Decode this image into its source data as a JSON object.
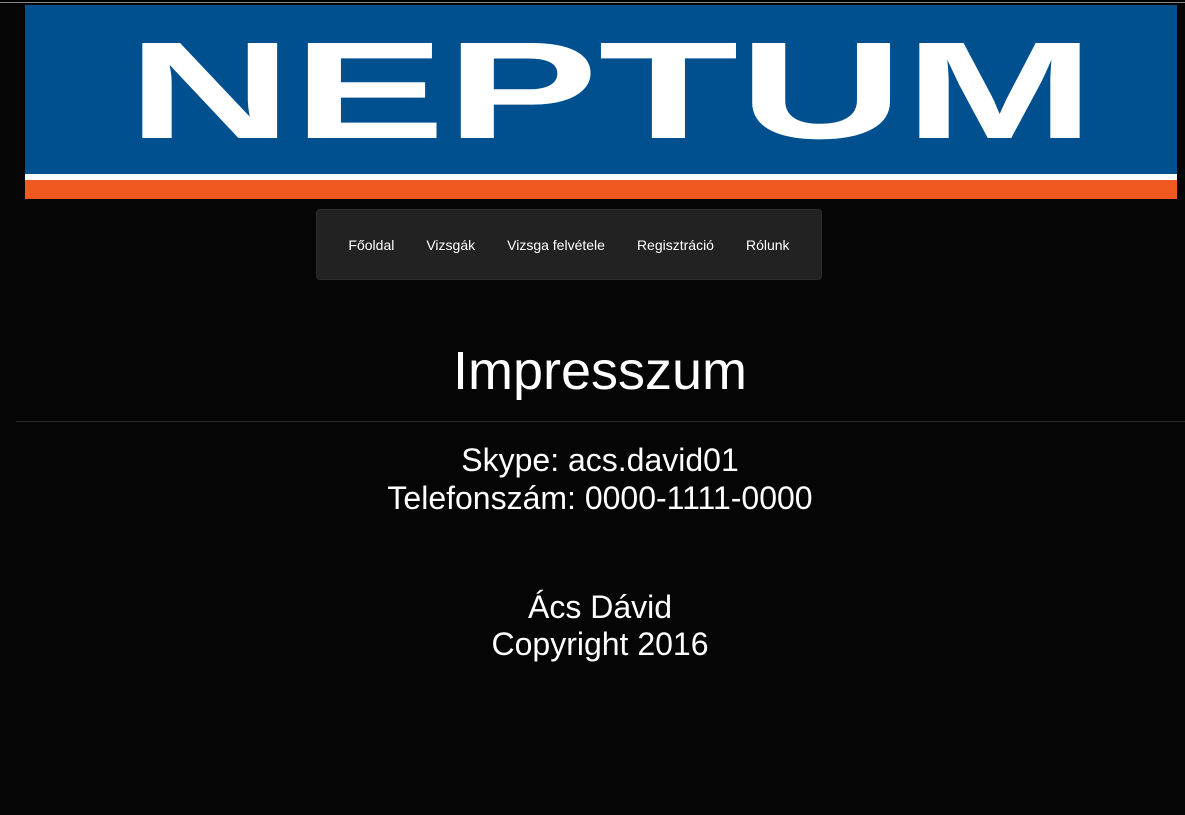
{
  "banner": {
    "logo_text": "NEPTUM",
    "colors": {
      "background": "#005090",
      "stripe_white": "#ffffff",
      "stripe_orange": "#f05a22",
      "logo_text": "#ffffff"
    }
  },
  "navbar": {
    "items": [
      {
        "label": "Főoldal"
      },
      {
        "label": "Vizsgák"
      },
      {
        "label": "Vizsga felvétele"
      },
      {
        "label": "Regisztráció"
      },
      {
        "label": "Rólunk"
      }
    ]
  },
  "main": {
    "title": "Impresszum",
    "contact": {
      "skype": "Skype: acs.david01",
      "phone": "Telefonszám: 0000-1111-0000"
    },
    "footer": {
      "author": "Ács Dávid",
      "copyright": "Copyright 2016"
    }
  },
  "colors": {
    "page_background": "#050505",
    "navbar_background": "#222222",
    "text": "#ffffff"
  }
}
